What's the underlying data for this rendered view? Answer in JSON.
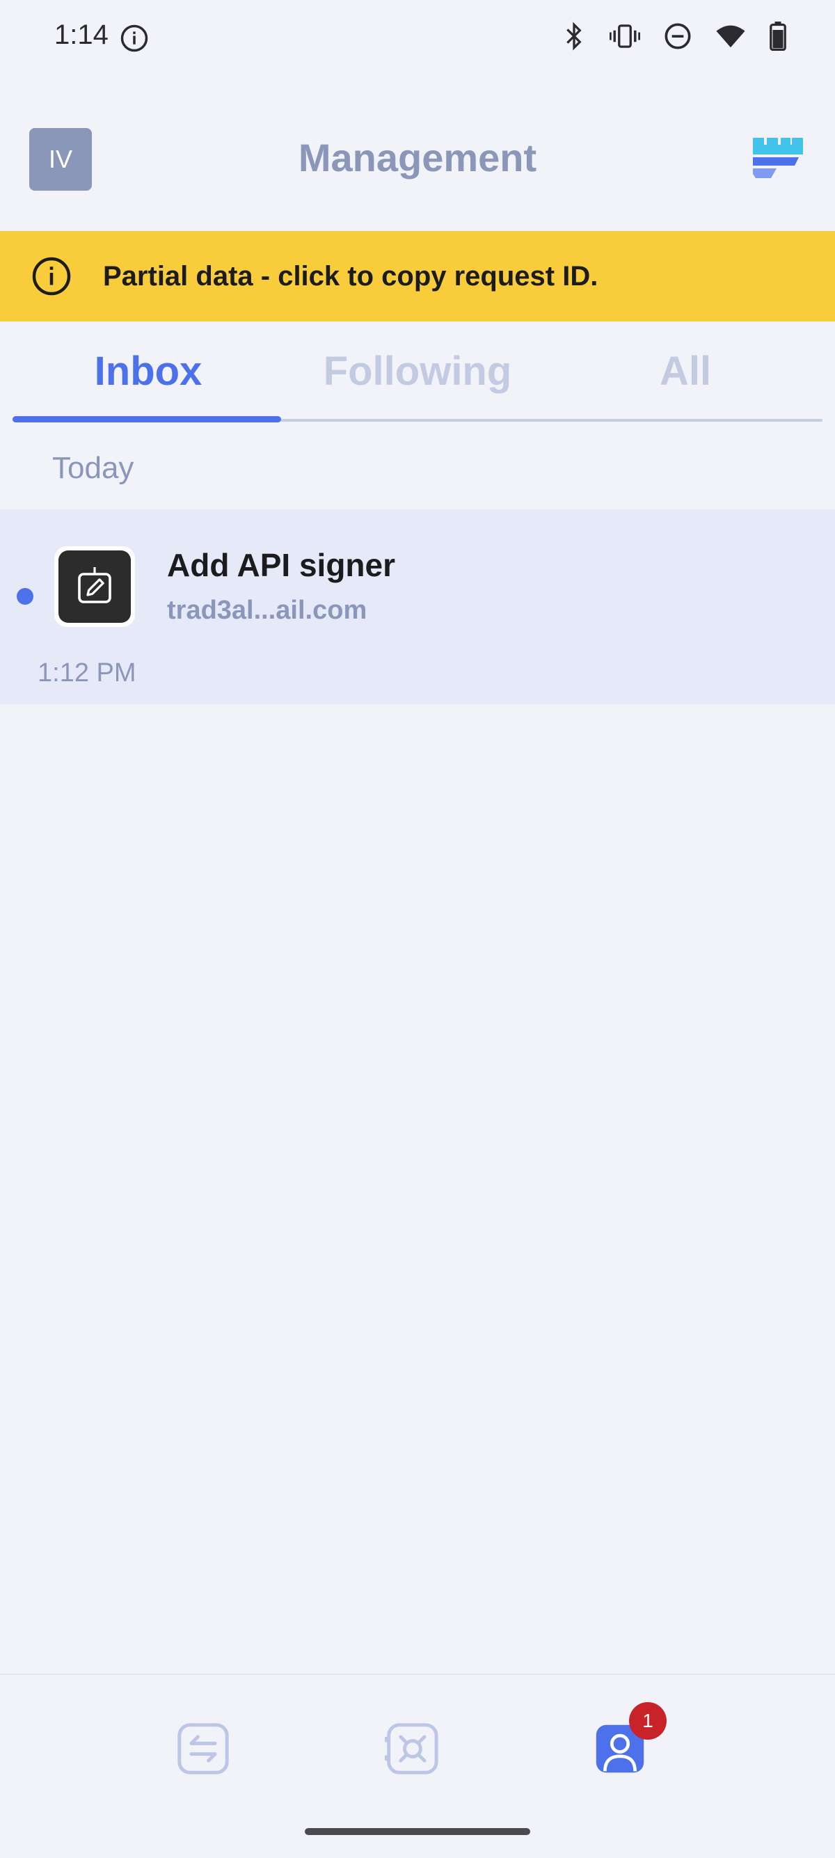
{
  "status_bar": {
    "time": "1:14"
  },
  "header": {
    "avatar_initials": "IV",
    "title": "Management"
  },
  "banner": {
    "text": "Partial data - click to copy request ID."
  },
  "tabs": [
    {
      "label": "Inbox",
      "active": true
    },
    {
      "label": "Following",
      "active": false
    },
    {
      "label": "All",
      "active": false
    }
  ],
  "section": {
    "label": "Today"
  },
  "items": [
    {
      "title": "Add API signer",
      "subtitle": "trad3al...ail.com",
      "time": "1:12 PM",
      "unread": true,
      "icon": "edit-document-icon"
    }
  ],
  "bottom_nav": {
    "items": [
      {
        "icon": "transfer-icon",
        "active": false
      },
      {
        "icon": "vault-icon",
        "active": false
      },
      {
        "icon": "profile-icon",
        "active": true
      }
    ],
    "profile_badge": "1"
  },
  "colors": {
    "accent": "#4c71ea",
    "banner": "#f8cc3b",
    "muted": "#8a97b9",
    "badge": "#c9232a"
  }
}
